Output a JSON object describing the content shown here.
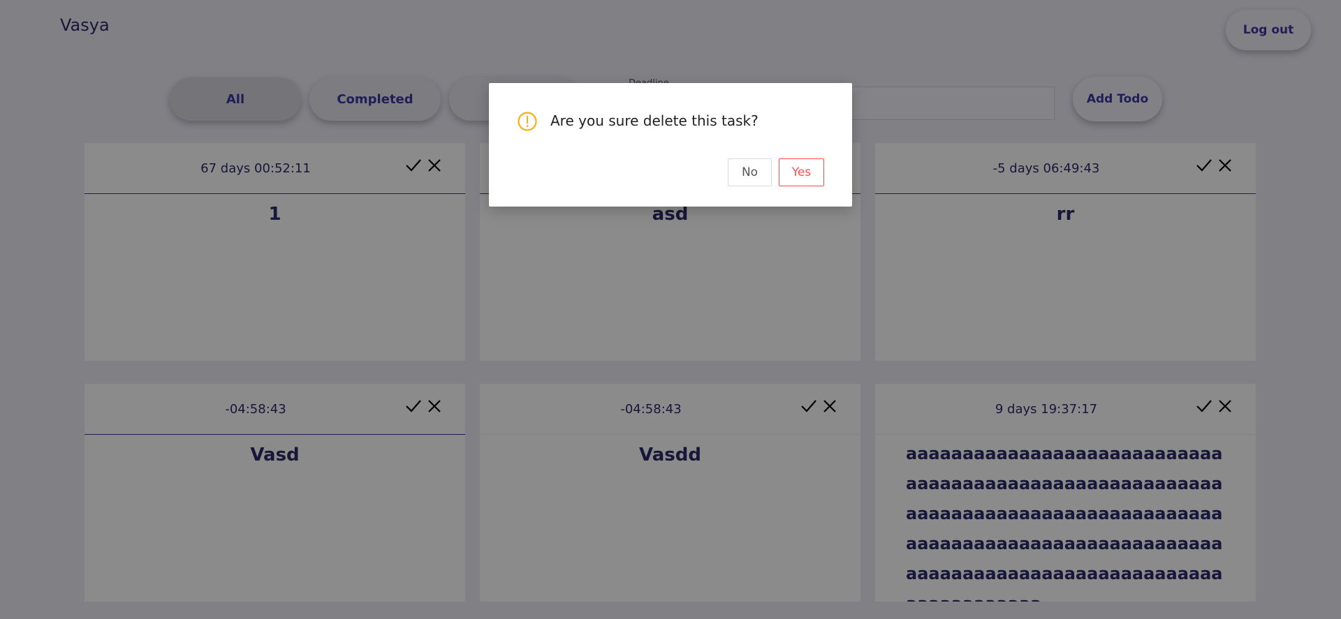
{
  "header": {
    "username": "Vasya",
    "logout_label": "Log out"
  },
  "toolbar": {
    "filters": [
      "All",
      "Completed",
      ""
    ],
    "deadline_label": "Deadline",
    "todo_placeholder": "",
    "add_label": "Add Todo"
  },
  "todos": [
    {
      "timer": "67 days 00:52:11",
      "title": "1"
    },
    {
      "timer": "",
      "title": "asd"
    },
    {
      "timer": "-5 days 06:49:43",
      "title": "rr"
    },
    {
      "timer": "-04:58:43",
      "title": "Vasd"
    },
    {
      "timer": "-04:58:43",
      "title": "Vasdd"
    },
    {
      "timer": "9 days 19:37:17",
      "title": "aaaaaaaaaaaaaaaaaaaaaaaaaaaaaaaaaaaaaaaaaaaaaaaaaaaaaaaaaaaaaaaaaaaaaaaaaaaaaaaaaaaaaaaaaaaaaaaaaaaaaaaaaaaaaaaaaaaaaaaaaaaaaaaaaaaaaaaaaaaaaaaaaaaaaaaa"
    }
  ],
  "modal": {
    "message": "Are you sure delete this task?",
    "no_label": "No",
    "yes_label": "Yes",
    "icon": "exclamation-circle-icon",
    "icon_color": "#faad14"
  },
  "colors": {
    "accent": "#3e33a0",
    "text": "#2c2868",
    "danger": "#ff4d4f"
  }
}
